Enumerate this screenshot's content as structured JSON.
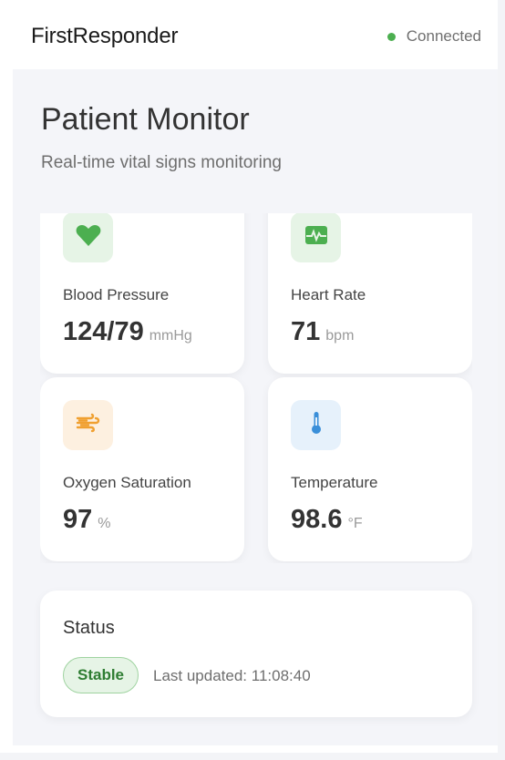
{
  "app": {
    "title": "FirstResponder",
    "connection_status": "Connected",
    "connection_color": "#4caf50"
  },
  "page": {
    "title": "Patient Monitor",
    "subtitle": "Real-time vital signs monitoring"
  },
  "vitals": [
    {
      "label": "Blood Pressure",
      "value": "124/79",
      "unit": "mmHg",
      "icon": "heart-icon",
      "icon_color": "#4caf50"
    },
    {
      "label": "Heart Rate",
      "value": "71",
      "unit": "bpm",
      "icon": "heart-pulse-icon",
      "icon_color": "#4caf50"
    },
    {
      "label": "Oxygen Saturation",
      "value": "97",
      "unit": "%",
      "icon": "wind-icon",
      "icon_color": "#f0a030"
    },
    {
      "label": "Temperature",
      "value": "98.6",
      "unit": "°F",
      "icon": "thermometer-icon",
      "icon_color": "#3a8fd9"
    }
  ],
  "status": {
    "title": "Status",
    "badge": "Stable",
    "badge_color": "#2e7d32",
    "last_updated": "Last updated: 11:08:40"
  }
}
